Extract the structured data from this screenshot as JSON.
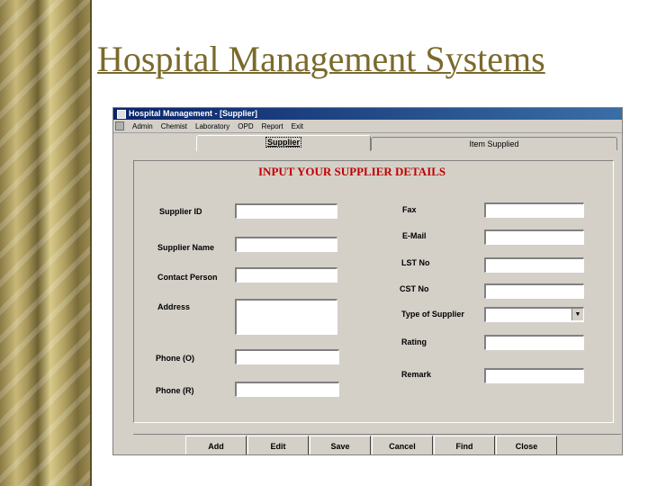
{
  "slide": {
    "title": "Hospital Management Systems"
  },
  "window": {
    "title": "Hospital Management - [Supplier]"
  },
  "menu": [
    "Admin",
    "Chemist",
    "Laboratory",
    "OPD",
    "Report",
    "Exit"
  ],
  "tabs": [
    {
      "label": "Supplier",
      "active": true
    },
    {
      "label": "Item Supplied",
      "active": false
    }
  ],
  "form": {
    "heading": "INPUT YOUR SUPPLIER DETAILS",
    "left_fields": [
      {
        "label": "Supplier ID",
        "value": ""
      },
      {
        "label": "Supplier Name",
        "value": ""
      },
      {
        "label": "Contact Person",
        "value": ""
      },
      {
        "label": "Address",
        "value": ""
      },
      {
        "label": "Phone (O)",
        "value": ""
      },
      {
        "label": "Phone (R)",
        "value": ""
      }
    ],
    "right_fields": [
      {
        "label": "Fax",
        "value": ""
      },
      {
        "label": "E-Mail",
        "value": ""
      },
      {
        "label": "LST No",
        "value": ""
      },
      {
        "label": "CST No",
        "value": ""
      },
      {
        "label": "Type of Supplier",
        "value": ""
      },
      {
        "label": "Rating",
        "value": ""
      },
      {
        "label": "Remark",
        "value": ""
      }
    ]
  },
  "buttons": [
    "Add",
    "Edit",
    "Save",
    "Cancel",
    "Find",
    "Close"
  ],
  "colors": {
    "heading": "#c00000",
    "title_gold": "#7a6a2c",
    "titlebar": "#0a246a"
  }
}
